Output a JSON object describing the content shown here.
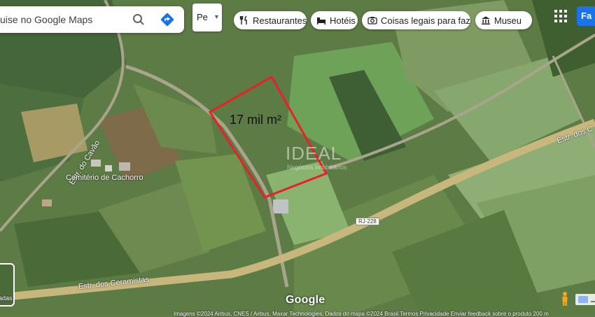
{
  "search": {
    "text": "uise no Google Maps"
  },
  "layers": {
    "label": "Pe"
  },
  "chips": [
    {
      "label": "Restaurantes",
      "icon": "fork-knife-icon"
    },
    {
      "label": "Hotéis",
      "icon": "bed-icon"
    },
    {
      "label": "Coisas legais para faz",
      "icon": "camera-icon"
    },
    {
      "label": "Museu",
      "icon": "museum-icon"
    }
  ],
  "signin": {
    "label": "Fa"
  },
  "map": {
    "area_label": "17 mil m²",
    "watermark": "IDEAL",
    "watermark_sub": "Negócios Imobiliários",
    "road_ceramistas": "Estr. dos Ceramistas",
    "road_cavao": "Estr. do Cavão",
    "road_right": "Estr. dos C",
    "shield": "RJ-228",
    "poi_cemetery": "Cemitério de Cachorro",
    "branding": "Google",
    "attribution": "Imagens ©2024 Airbus, CNES / Airbus, Maxar Technologies, Dados do mapa ©2024   Brasil   Termos   Privacidade   Enviar feedback sobre o produto   200 m",
    "thumb_label": "adas"
  },
  "colors": {
    "outline": "#e8202a",
    "road": "#c8b77c",
    "accent": "#1a73e8"
  }
}
